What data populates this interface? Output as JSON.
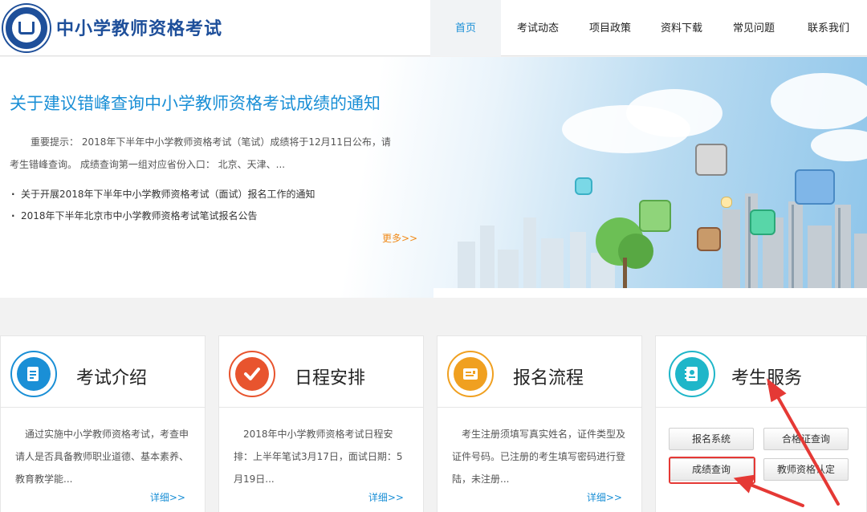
{
  "header": {
    "site_title": "中小学教师资格考试",
    "nav": [
      {
        "label": "首页",
        "active": true
      },
      {
        "label": "考试动态"
      },
      {
        "label": "项目政策"
      },
      {
        "label": "资料下载"
      },
      {
        "label": "常见问题"
      },
      {
        "label": "联系我们"
      }
    ]
  },
  "banner": {
    "headline": "关于建议错峰查询中小学教师资格考试成绩的通知",
    "description": "重要提示： 2018年下半年中小学教师资格考试（笔试）成绩将于12月11日公布，请考生错峰查询。 成绩查询第一组对应省份入口： 北京、天津、...",
    "news": [
      "关于开展2018年下半年中小学教师资格考试（面试）报名工作的通知",
      "2018年下半年北京市中小学教师资格考试笔试报名公告"
    ],
    "more_label": "更多>>"
  },
  "cards": [
    {
      "title": "考试介绍",
      "icon": "document-icon",
      "color": "#1a8fd6",
      "text": "通过实施中小学教师资格考试，考查申请人是否具备教师职业道德、基本素养、教育教学能...",
      "detail": "详细>>"
    },
    {
      "title": "日程安排",
      "icon": "checkmark-icon",
      "color": "#e8542e",
      "text": "2018年中小学教师资格考试日程安排：上半年笔试3月17日，面试日期：5月19日...",
      "detail": "详细>>"
    },
    {
      "title": "报名流程",
      "icon": "form-icon",
      "color": "#f0a020",
      "text": "考生注册须填写真实姓名，证件类型及证件号码。已注册的考生填写密码进行登陆，未注册...",
      "detail": "详细>>"
    },
    {
      "title": "考生服务",
      "icon": "contact-book-icon",
      "color": "#1fb6c9",
      "buttons": [
        "报名系统",
        "合格证查询",
        "成绩查询",
        "教师资格认定"
      ]
    }
  ],
  "colors": {
    "brand": "#1e4f9a",
    "accent": "#1a8fd6",
    "more": "#f08a1a",
    "annotation": "#e53935"
  }
}
